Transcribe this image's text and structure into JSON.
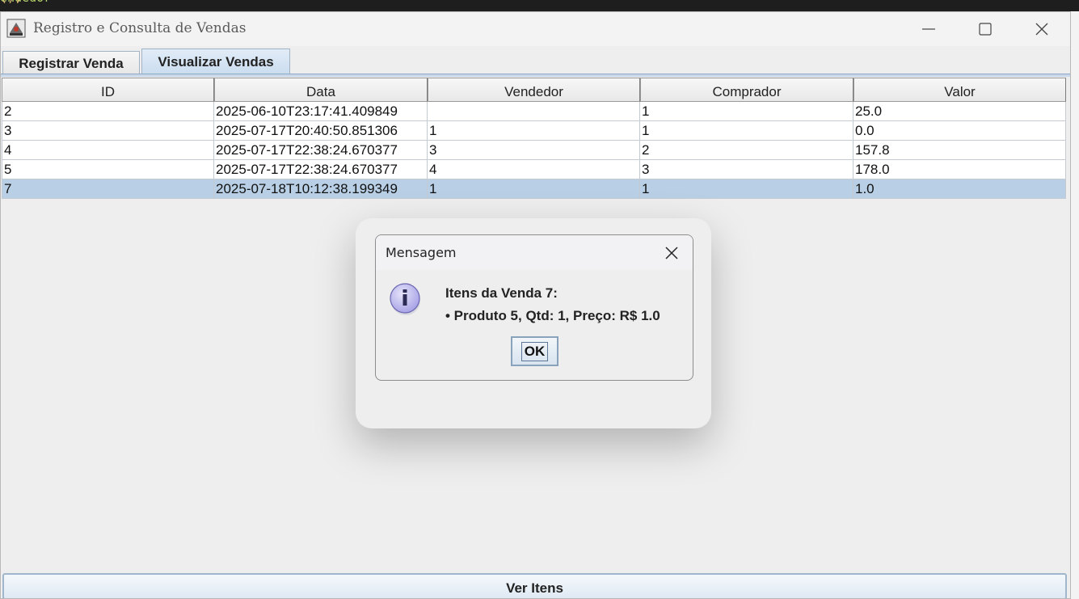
{
  "background": {
    "code_fn": "endedor",
    "code_punct": "();"
  },
  "window": {
    "title": "Registro e Consulta de Vendas"
  },
  "tabs": [
    {
      "label": "Registrar Venda",
      "selected": false
    },
    {
      "label": "Visualizar Vendas",
      "selected": true
    }
  ],
  "table": {
    "columns": [
      "ID",
      "Data",
      "Vendedor",
      "Comprador",
      "Valor"
    ],
    "rows": [
      [
        "2",
        "2025-06-10T23:17:41.409849",
        "",
        "1",
        "25.0"
      ],
      [
        "3",
        "2025-07-17T20:40:50.851306",
        "1",
        "1",
        "0.0"
      ],
      [
        "4",
        "2025-07-17T22:38:24.670377",
        "3",
        "2",
        "157.8"
      ],
      [
        "5",
        "2025-07-17T22:38:24.670377",
        "4",
        "3",
        "178.0"
      ],
      [
        "7",
        "2025-07-18T10:12:38.199349",
        "1",
        "1",
        "1.0"
      ]
    ],
    "selected_row": 4
  },
  "actions": {
    "ver_itens_label": "Ver Itens"
  },
  "dialog": {
    "title": "Mensagem",
    "icon": "info-icon",
    "message_line1": "Itens da Venda 7:",
    "message_line2": "• Produto 5, Qtd: 1, Preço: R$ 1.0",
    "ok_label": "OK"
  },
  "colors": {
    "selection": "#b8cfe5",
    "tab_active": "#c9dcef",
    "info_icon": "#b9b5ec"
  }
}
